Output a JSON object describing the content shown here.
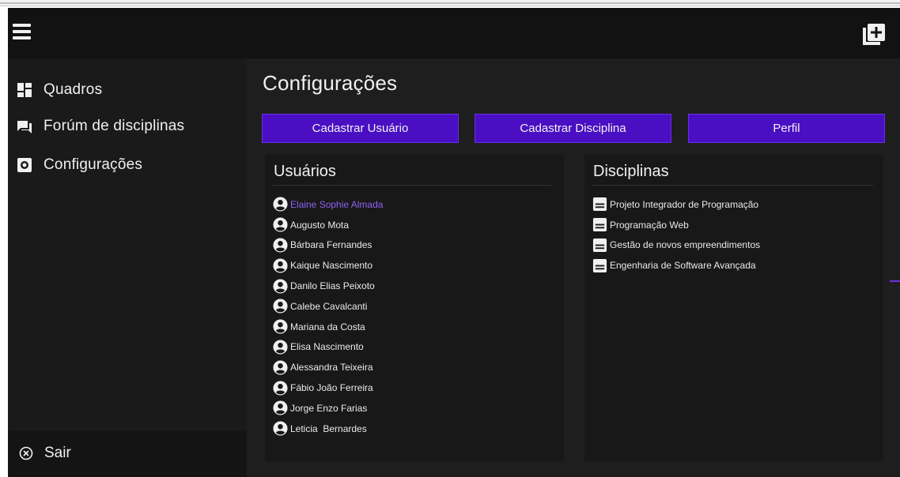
{
  "appbar": {
    "menu_icon": "menu-icon",
    "add_icon": "add-box-icon"
  },
  "sidebar": {
    "items": [
      {
        "label": "Quadros",
        "icon": "dashboard-icon"
      },
      {
        "label": "Forúm de disciplinas",
        "icon": "forum-icon"
      },
      {
        "label": "Configurações",
        "icon": "settings-icon"
      }
    ],
    "logout_label": "Sair",
    "logout_icon": "close-circle-icon"
  },
  "main": {
    "title": "Configurações",
    "buttons": {
      "register_user": "Cadastrar Usuário",
      "register_course": "Cadastrar Disciplina",
      "profile": "Perfil"
    },
    "users_panel": {
      "title": "Usuários",
      "items": [
        "Elaine Sophie Almada",
        "Augusto Mota",
        "Bárbara Fernandes",
        "Kaique Nascimento",
        "Danilo Elias Peixoto",
        "Calebe Cavalcanti",
        "Mariana da Costa",
        "Elisa Nascimento",
        "Alessandra Teixeira",
        "Fábio João Ferreira",
        "Jorge Enzo Farias",
        "Leticia  Bernardes"
      ],
      "selected_index": 0
    },
    "courses_panel": {
      "title": "Disciplinas",
      "items": [
        "Projeto Integrador de Programação",
        "Programação Web",
        "Gestão de novos empreendimentos",
        "Engenharia de Software Avançada"
      ]
    }
  },
  "colors": {
    "accent": "#4a0fc2",
    "selected_text": "#8d63f0",
    "appbar_bg": "#121212",
    "content_bg": "#1e1e1e"
  }
}
